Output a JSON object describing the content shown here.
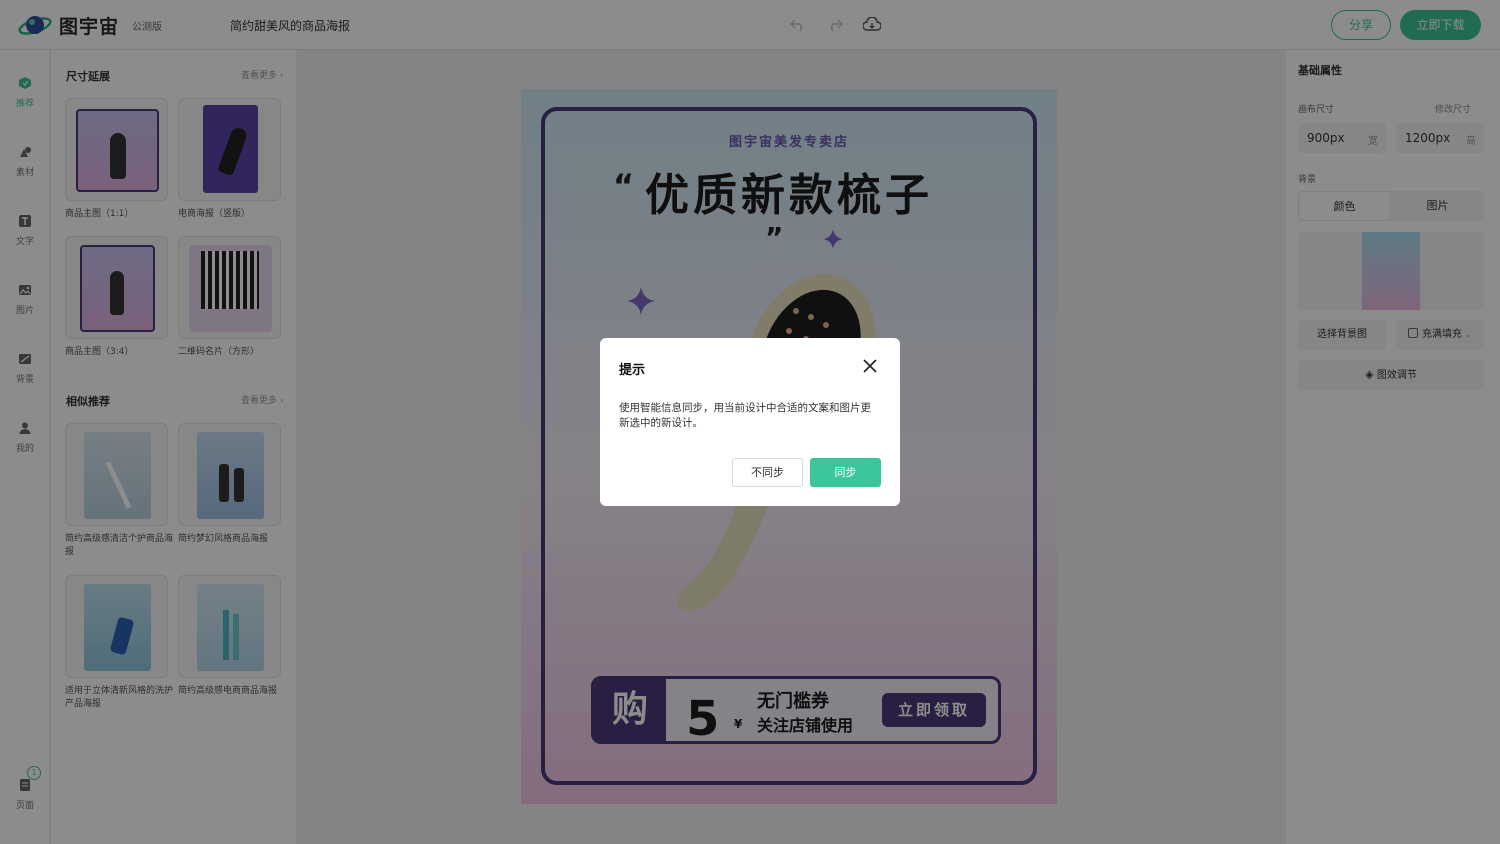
{
  "app": {
    "name": "图宇宙",
    "badge": "公测版",
    "doc_title": "简约甜美风的商品海报"
  },
  "toolbar": {
    "undo_icon": "undo-icon",
    "redo_icon": "redo-icon",
    "cloud_icon": "cloud-save-icon",
    "share": "分享",
    "download": "立即下载"
  },
  "rail": {
    "items": [
      {
        "label": "推荐",
        "icon": "recommend-icon",
        "active": true
      },
      {
        "label": "素材",
        "icon": "shapes-icon"
      },
      {
        "label": "文字",
        "icon": "text-icon"
      },
      {
        "label": "图片",
        "icon": "image-icon"
      },
      {
        "label": "背景",
        "icon": "background-icon"
      },
      {
        "label": "我的",
        "icon": "user-icon"
      }
    ],
    "pages": {
      "label": "页面",
      "count": "1"
    }
  },
  "left_panel": {
    "size_section": {
      "title": "尺寸延展",
      "more": "查看更多",
      "items": [
        {
          "label": "商品主图（1:1）"
        },
        {
          "label": "电商海报（竖版）"
        },
        {
          "label": "商品主图（3:4）"
        },
        {
          "label": "二维码名片（方形）"
        }
      ]
    },
    "similar_section": {
      "title": "相似推荐",
      "more": "查看更多",
      "items": [
        {
          "label": "简约高级感清洁个护商品海报"
        },
        {
          "label": "简约梦幻风格商品海报"
        },
        {
          "label": "适用于立体清新风格的洗护产品海报"
        },
        {
          "label": "简约高级感电商商品海报"
        }
      ]
    }
  },
  "poster": {
    "store": "图宇宙美发专卖店",
    "quote_open": "“",
    "headline": "优质新款梳子",
    "quote_close": "”",
    "coupon": {
      "left": "购",
      "amount": "5",
      "currency": "¥",
      "line1": "无门槛券",
      "line2": "关注店铺使用",
      "button": "立即领取"
    }
  },
  "right_panel": {
    "title": "基础属性",
    "canvas_size_label": "画布尺寸",
    "edit_size": "修改尺寸",
    "width": {
      "value": "900px",
      "unit": "宽"
    },
    "height": {
      "value": "1200px",
      "unit": "高"
    },
    "bg_label": "背景",
    "tabs": [
      "颜色",
      "图片"
    ],
    "choose_bg": "选择背景图",
    "fill_mode": "充满填充",
    "adjust": "图效调节"
  },
  "dialog": {
    "title": "提示",
    "message": "使用智能信息同步，用当前设计中合适的文案和图片更新选中的新设计。",
    "cancel": "不同步",
    "confirm": "同步"
  },
  "colors": {
    "accent": "#3cc49a",
    "poster_dark": "#4a3a78",
    "poster_purple": "#6a58b0"
  }
}
